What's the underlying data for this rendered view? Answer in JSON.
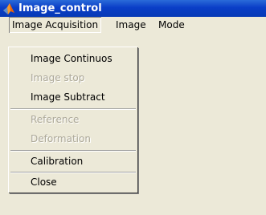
{
  "window": {
    "title": "Image_control",
    "icon": "matlab-icon"
  },
  "menubar": {
    "items": [
      {
        "label": "Image Acquisition"
      },
      {
        "label": "Image"
      },
      {
        "label": "Mode"
      }
    ]
  },
  "dropdown": {
    "items": [
      {
        "label": "Image Continuos",
        "enabled": true
      },
      {
        "label": "Image stop",
        "enabled": false
      },
      {
        "label": "Image Subtract",
        "enabled": true
      },
      {
        "label": "Reference",
        "enabled": false
      },
      {
        "label": "Deformation",
        "enabled": false
      },
      {
        "label": "Calibration",
        "enabled": true
      },
      {
        "label": "Close",
        "enabled": true
      }
    ]
  },
  "colors": {
    "titlebar": "#0A3EC7",
    "window_background": "#ECE9D8",
    "disabled_text": "#ACA899"
  }
}
